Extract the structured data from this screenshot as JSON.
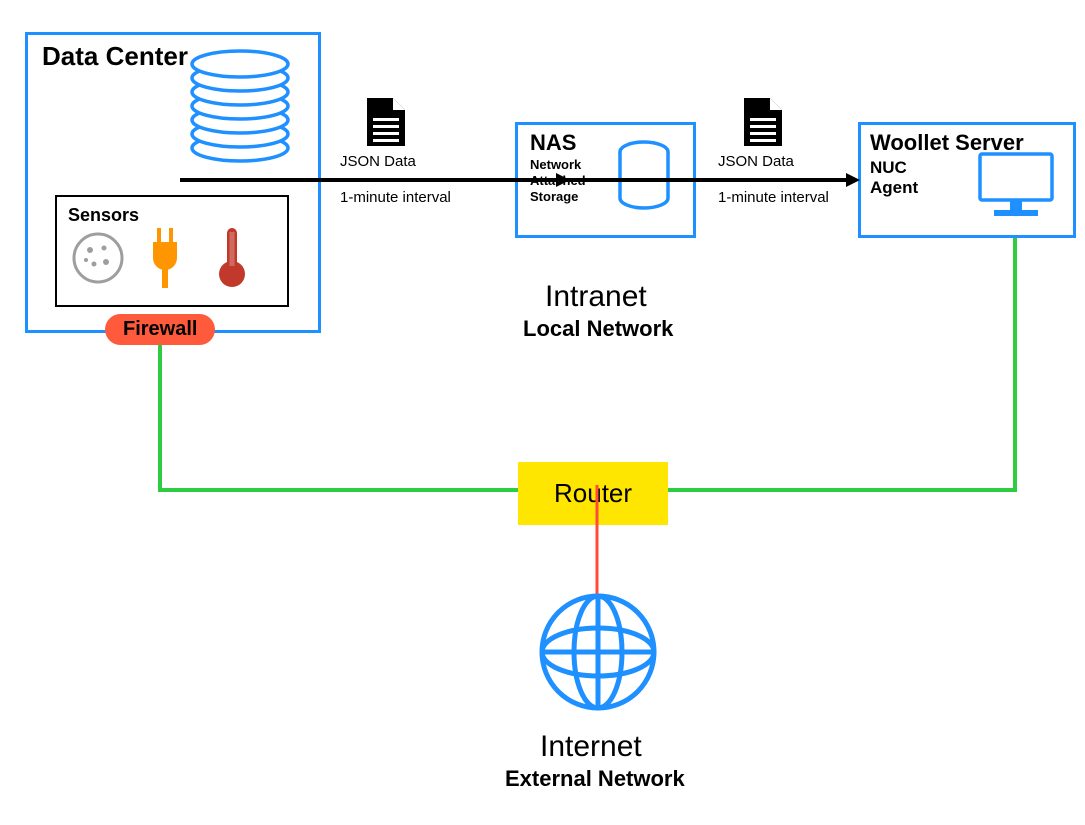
{
  "datacenter": {
    "title": "Data Center",
    "sensors_title": "Sensors"
  },
  "firewall_label": "Firewall",
  "flow1": {
    "top": "JSON Data",
    "bottom": "1-minute interval"
  },
  "nas": {
    "title": "NAS",
    "line1": "Network",
    "line2": "Attached",
    "line3": "Storage"
  },
  "flow2": {
    "top": "JSON Data",
    "bottom": "1-minute interval"
  },
  "woollet": {
    "title": "Woollet Server",
    "sub1": "NUC",
    "sub2": "Agent"
  },
  "intranet": {
    "title": "Intranet",
    "sub": "Local Network"
  },
  "router_label": "Router",
  "internet": {
    "title": "Internet",
    "sub": "External Network"
  },
  "colors": {
    "blue": "#1e90ff",
    "green": "#2ecc40",
    "red": "#ff4b3a",
    "yellow": "#ffe600",
    "orange": "#ff9500",
    "darkred": "#c0392b"
  }
}
